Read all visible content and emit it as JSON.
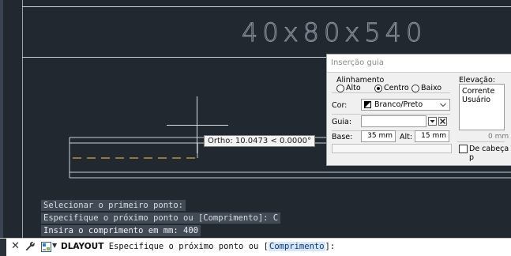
{
  "drawing": {
    "title_text": "40x80x540",
    "tooltip": "Ortho: 10.0473 < 0.0000°"
  },
  "command_history": [
    "Selecionar o primeiro ponto:",
    "Especifique o próximo ponto ou [Comprimento]: C",
    "Insira o comprimento em mm: 400"
  ],
  "command_line": {
    "command": "DLAYOUT",
    "prompt_before": " Especifique o próximo ponto ou [",
    "option": "Comprimento",
    "prompt_after": "]:"
  },
  "dialog": {
    "title": "Inserção guia",
    "alignment": {
      "label": "Alinhamento",
      "options": [
        "Alto",
        "Centro",
        "Baixo"
      ],
      "selected": "Centro"
    },
    "color": {
      "label": "Cor:",
      "value": "Branco/Preto"
    },
    "guide": {
      "label": "Guia:",
      "value": ""
    },
    "base": {
      "label": "Base:",
      "value": "35 mm"
    },
    "height": {
      "label": "Alt:",
      "value": "15 mm"
    },
    "elevation": {
      "label": "Elevação:",
      "items": [
        "Corrente",
        "Usuário"
      ],
      "value": "0 mm"
    },
    "upside_down": {
      "label": "De cabeça p",
      "checked": false
    }
  },
  "colors": {
    "viewport_bg": "#212830",
    "dash_line": "#d9a441",
    "option_highlight": "#d6e6f8"
  }
}
